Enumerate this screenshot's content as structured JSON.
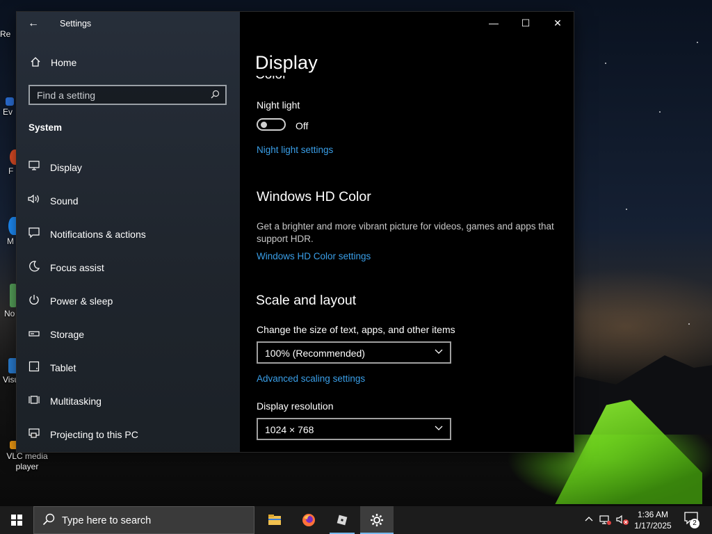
{
  "desktop": {
    "icons": [
      {
        "label": "Re",
        "color": "#d0d0d0"
      },
      {
        "label": "Ev",
        "color": "#2b6fd6"
      },
      {
        "label": "F",
        "color": "#e34e26"
      },
      {
        "label": "M",
        "color": "#1e90ff"
      },
      {
        "label": "No",
        "color": "#58a55c"
      },
      {
        "label": "Visu",
        "color": "#2a7fd6"
      },
      {
        "label": "VLC media player",
        "color": "#f39c12"
      }
    ]
  },
  "window": {
    "app_title": "Settings",
    "back_icon": "arrow-left-icon",
    "controls": {
      "minimize": "—",
      "maximize": "☐",
      "close": "✕"
    }
  },
  "sidebar": {
    "home_label": "Home",
    "search_placeholder": "Find a setting",
    "section_title": "System",
    "items": [
      {
        "label": "Display",
        "icon": "monitor-icon"
      },
      {
        "label": "Sound",
        "icon": "speaker-icon"
      },
      {
        "label": "Notifications & actions",
        "icon": "notification-icon"
      },
      {
        "label": "Focus assist",
        "icon": "moon-icon"
      },
      {
        "label": "Power & sleep",
        "icon": "power-icon"
      },
      {
        "label": "Storage",
        "icon": "storage-icon"
      },
      {
        "label": "Tablet",
        "icon": "tablet-icon"
      },
      {
        "label": "Multitasking",
        "icon": "multitasking-icon"
      },
      {
        "label": "Projecting to this PC",
        "icon": "projecting-icon"
      }
    ]
  },
  "content": {
    "page_title": "Display",
    "clipped_heading": "Color",
    "night_light": {
      "label": "Night light",
      "state": "Off",
      "settings_link": "Night light settings"
    },
    "hd_color": {
      "title": "Windows HD Color",
      "description": "Get a brighter and more vibrant picture for videos, games and apps that support HDR.",
      "link": "Windows HD Color settings"
    },
    "scale": {
      "title": "Scale and layout",
      "size_label": "Change the size of text, apps, and other items",
      "size_value": "100% (Recommended)",
      "advanced_link": "Advanced scaling settings",
      "resolution_label": "Display resolution",
      "resolution_value": "1024 × 768"
    }
  },
  "taskbar": {
    "search_placeholder": "Type here to search",
    "apps": [
      {
        "name": "file-explorer-icon",
        "color": "#f2c14e"
      },
      {
        "name": "firefox-icon",
        "color": "#ff7139"
      },
      {
        "name": "roblox-icon",
        "color": "#d8d8d8"
      },
      {
        "name": "settings-icon",
        "color": "#ffffff"
      }
    ],
    "clock_time": "1:36 AM",
    "clock_date": "1/17/2025",
    "notification_count": "2"
  },
  "theme": {
    "accent_link": "#3a9fe8",
    "taskbar_indicator": "#76b9ed"
  }
}
